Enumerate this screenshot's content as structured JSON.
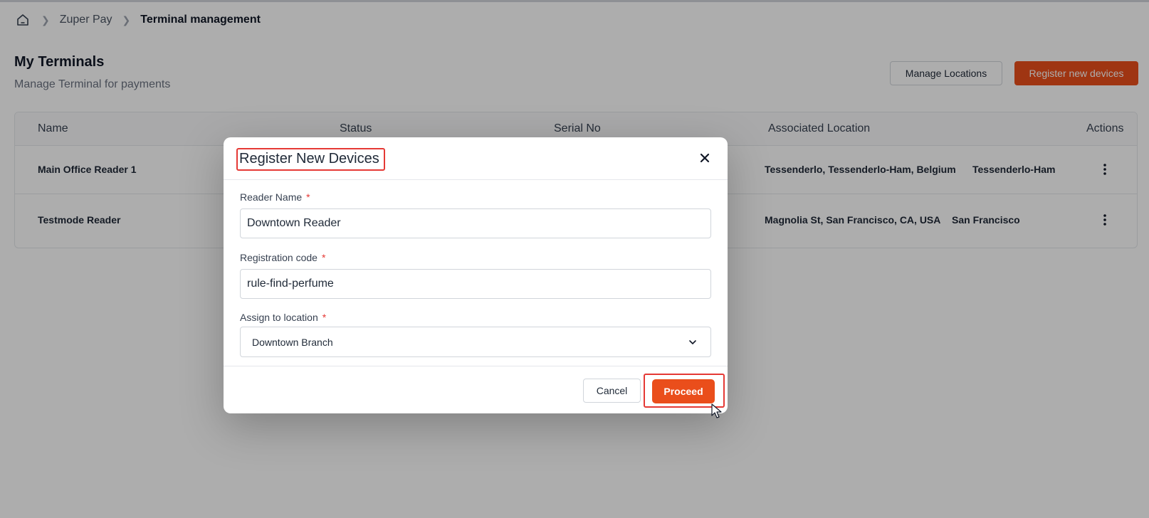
{
  "breadcrumb": {
    "home_icon": "home-icon",
    "items": [
      "Zuper Pay",
      "Terminal management"
    ]
  },
  "header": {
    "title": "My Terminals",
    "subtitle": "Manage Terminal for payments",
    "manage_locations_label": "Manage Locations",
    "register_label": "Register new devices"
  },
  "table": {
    "columns": [
      "Name",
      "Status",
      "Serial No",
      "Associated Location",
      "Actions"
    ],
    "rows": [
      {
        "name": "Main Office Reader 1",
        "location": "Tessenderlo, Tessenderlo-Ham, Belgium",
        "location_short": "Tessenderlo-Ham",
        "actions_icon": "kebab-menu-icon"
      },
      {
        "name": "Testmode Reader",
        "location": "Magnolia St, San Francisco, CA, USA",
        "location_short": "San Francisco",
        "actions_icon": "kebab-menu-icon"
      }
    ]
  },
  "modal": {
    "title": "Register New Devices",
    "close_icon": "close-icon",
    "fields": {
      "reader_name": {
        "label": "Reader Name",
        "required": "*",
        "value": "Downtown Reader"
      },
      "registration_code": {
        "label": "Registration code",
        "required": "*",
        "value": "rule-find-perfume"
      },
      "location": {
        "label": "Assign to location",
        "required": "*",
        "value": "Downtown Branch"
      }
    },
    "cancel_label": "Cancel",
    "proceed_label": "Proceed"
  },
  "colors": {
    "accent": "#ea4e1b",
    "highlight": "#e53935",
    "overlay": "rgba(0,0,0,0.32)"
  }
}
